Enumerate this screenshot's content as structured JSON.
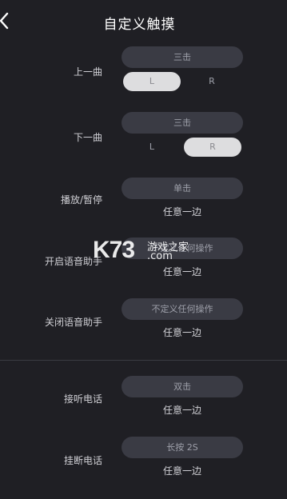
{
  "header": {
    "title": "自定义触摸",
    "back_icon": "chevron-left-icon"
  },
  "rows": [
    {
      "label": "上一曲",
      "action": "三击",
      "side_left": "L",
      "side_right": "R",
      "selected_side": "L"
    },
    {
      "label": "下一曲",
      "action": "三击",
      "side_left": "L",
      "side_right": "R",
      "selected_side": "R"
    },
    {
      "label": "播放/暂停",
      "action": "单击",
      "side": "任意一边"
    },
    {
      "label": "开启语音助手",
      "action": "不定义任何操作",
      "side": "任意一边"
    },
    {
      "label": "关闭语音助手",
      "action": "不定义任何操作",
      "side": "任意一边"
    },
    {
      "label": "接听电话",
      "action": "双击",
      "side": "任意一边"
    },
    {
      "label": "挂断电话",
      "action": "长按 2S",
      "side": "任意一边"
    }
  ],
  "watermark": {
    "logo": "K73",
    "site": "游戏之家",
    "domain": ".com"
  },
  "colors": {
    "background": "#1f1f24",
    "pill": "#3a3b44",
    "active_toggle": "#dddddf",
    "text": "#cfcfd4"
  }
}
